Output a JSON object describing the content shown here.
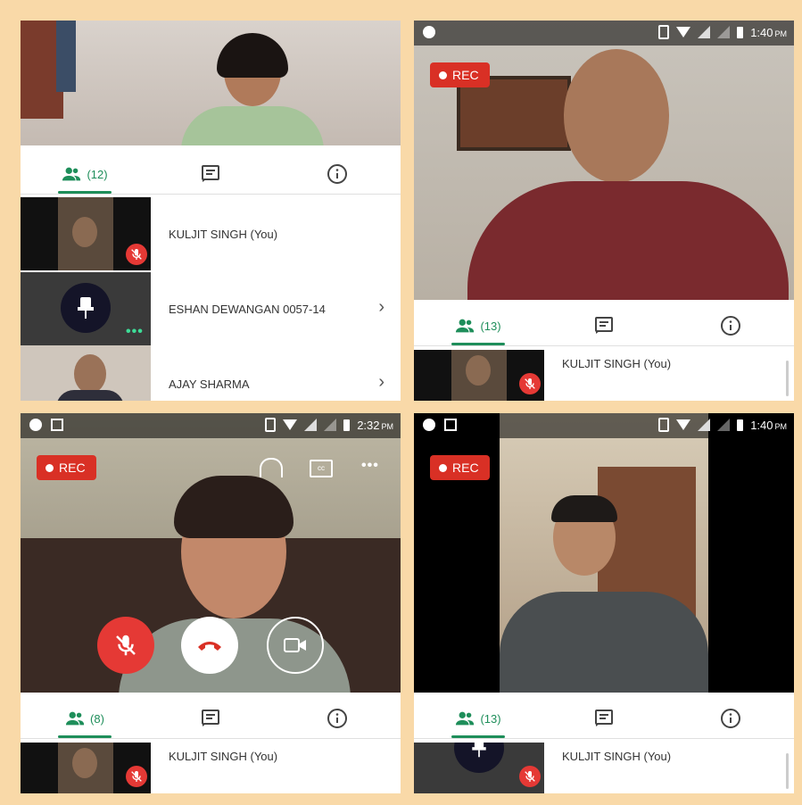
{
  "colors": {
    "accent": "#1e8e5a",
    "rec": "#d93025",
    "micoff": "#e53935",
    "background": "#f9d9a8"
  },
  "panels": [
    {
      "id": "top-left",
      "tab_count": "(12)",
      "participants": [
        {
          "name": "KULJIT SINGH (You)",
          "muted": true
        },
        {
          "name": "ESHAN DEWANGAN 0057-14",
          "icon": "pin-icon"
        },
        {
          "name": "AJAY SHARMA"
        }
      ]
    },
    {
      "id": "top-right",
      "time": "1:40",
      "ampm": "PM",
      "rec": "REC",
      "tab_count": "(13)",
      "participants": [
        {
          "name": "KULJIT SINGH (You)",
          "muted": true
        }
      ]
    },
    {
      "id": "bottom-left",
      "time": "2:32",
      "ampm": "PM",
      "rec": "REC",
      "tab_count": "(8)",
      "participants": [
        {
          "name": "KULJIT SINGH (You)",
          "muted": true
        }
      ],
      "controls": [
        "mic-off-icon",
        "end-call-icon",
        "video-icon"
      ],
      "top_icons": [
        "headphones-icon",
        "captions-icon",
        "more-icon"
      ]
    },
    {
      "id": "bottom-right",
      "time": "1:40",
      "ampm": "PM",
      "rec": "REC",
      "tab_count": "(13)",
      "participants": [
        {
          "name": "KULJIT SINGH (You)",
          "muted": true
        }
      ]
    }
  ]
}
